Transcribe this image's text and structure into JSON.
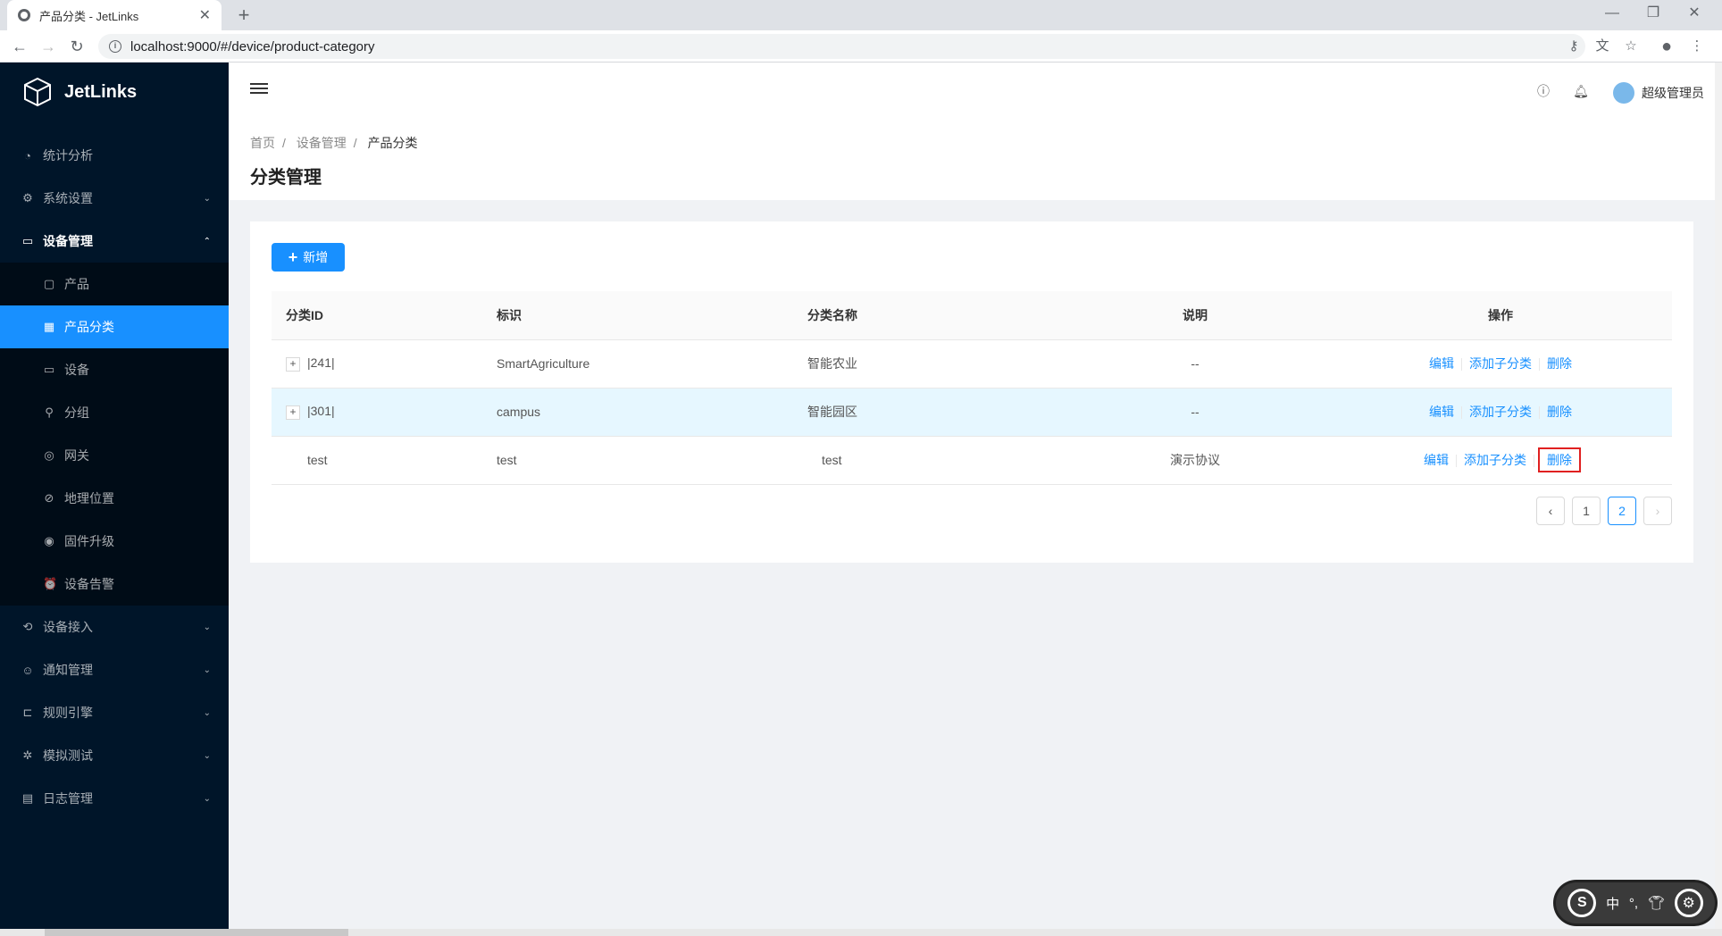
{
  "browser": {
    "tab_title": "产品分类 - JetLinks",
    "url": "localhost:9000/#/device/product-category"
  },
  "app": {
    "name": "JetLinks"
  },
  "sidebar": {
    "items": [
      {
        "label": "统计分析",
        "icon": "dashboard-icon",
        "has_arrow": false
      },
      {
        "label": "系统设置",
        "icon": "gear-icon",
        "has_arrow": true
      },
      {
        "label": "设备管理",
        "icon": "device-icon",
        "has_arrow": true,
        "open": true,
        "children": [
          {
            "label": "产品",
            "icon": "product-icon"
          },
          {
            "label": "产品分类",
            "icon": "category-icon",
            "selected": true
          },
          {
            "label": "设备",
            "icon": "monitor-icon"
          },
          {
            "label": "分组",
            "icon": "group-icon"
          },
          {
            "label": "网关",
            "icon": "globe-icon"
          },
          {
            "label": "地理位置",
            "icon": "compass-icon"
          },
          {
            "label": "固件升级",
            "icon": "firmware-icon"
          },
          {
            "label": "设备告警",
            "icon": "alarm-icon"
          }
        ]
      },
      {
        "label": "设备接入",
        "icon": "access-icon",
        "has_arrow": true
      },
      {
        "label": "通知管理",
        "icon": "notify-icon",
        "has_arrow": true
      },
      {
        "label": "规则引擎",
        "icon": "rule-icon",
        "has_arrow": true
      },
      {
        "label": "模拟测试",
        "icon": "bug-icon",
        "has_arrow": true
      },
      {
        "label": "日志管理",
        "icon": "calendar-icon",
        "has_arrow": true
      }
    ]
  },
  "header": {
    "username": "超级管理员"
  },
  "breadcrumb": [
    "首页",
    "设备管理",
    "产品分类"
  ],
  "page_title": "分类管理",
  "add_button": "新增",
  "table": {
    "columns": [
      "分类ID",
      "标识",
      "分类名称",
      "说明",
      "操作"
    ],
    "rows": [
      {
        "id": "|241|",
        "key": "SmartAgriculture",
        "name": "智能农业",
        "desc": "--",
        "expandable": true
      },
      {
        "id": "|301|",
        "key": "campus",
        "name": "智能园区",
        "desc": "--",
        "expandable": true
      },
      {
        "id": "test",
        "key": "test",
        "name": "test",
        "desc": "演示协议",
        "expandable": false
      }
    ],
    "actions": {
      "edit": "编辑",
      "add_child": "添加子分类",
      "delete": "删除"
    }
  },
  "pagination": {
    "pages": [
      "1",
      "2"
    ],
    "current": "2"
  },
  "ime": {
    "lang": "中"
  }
}
